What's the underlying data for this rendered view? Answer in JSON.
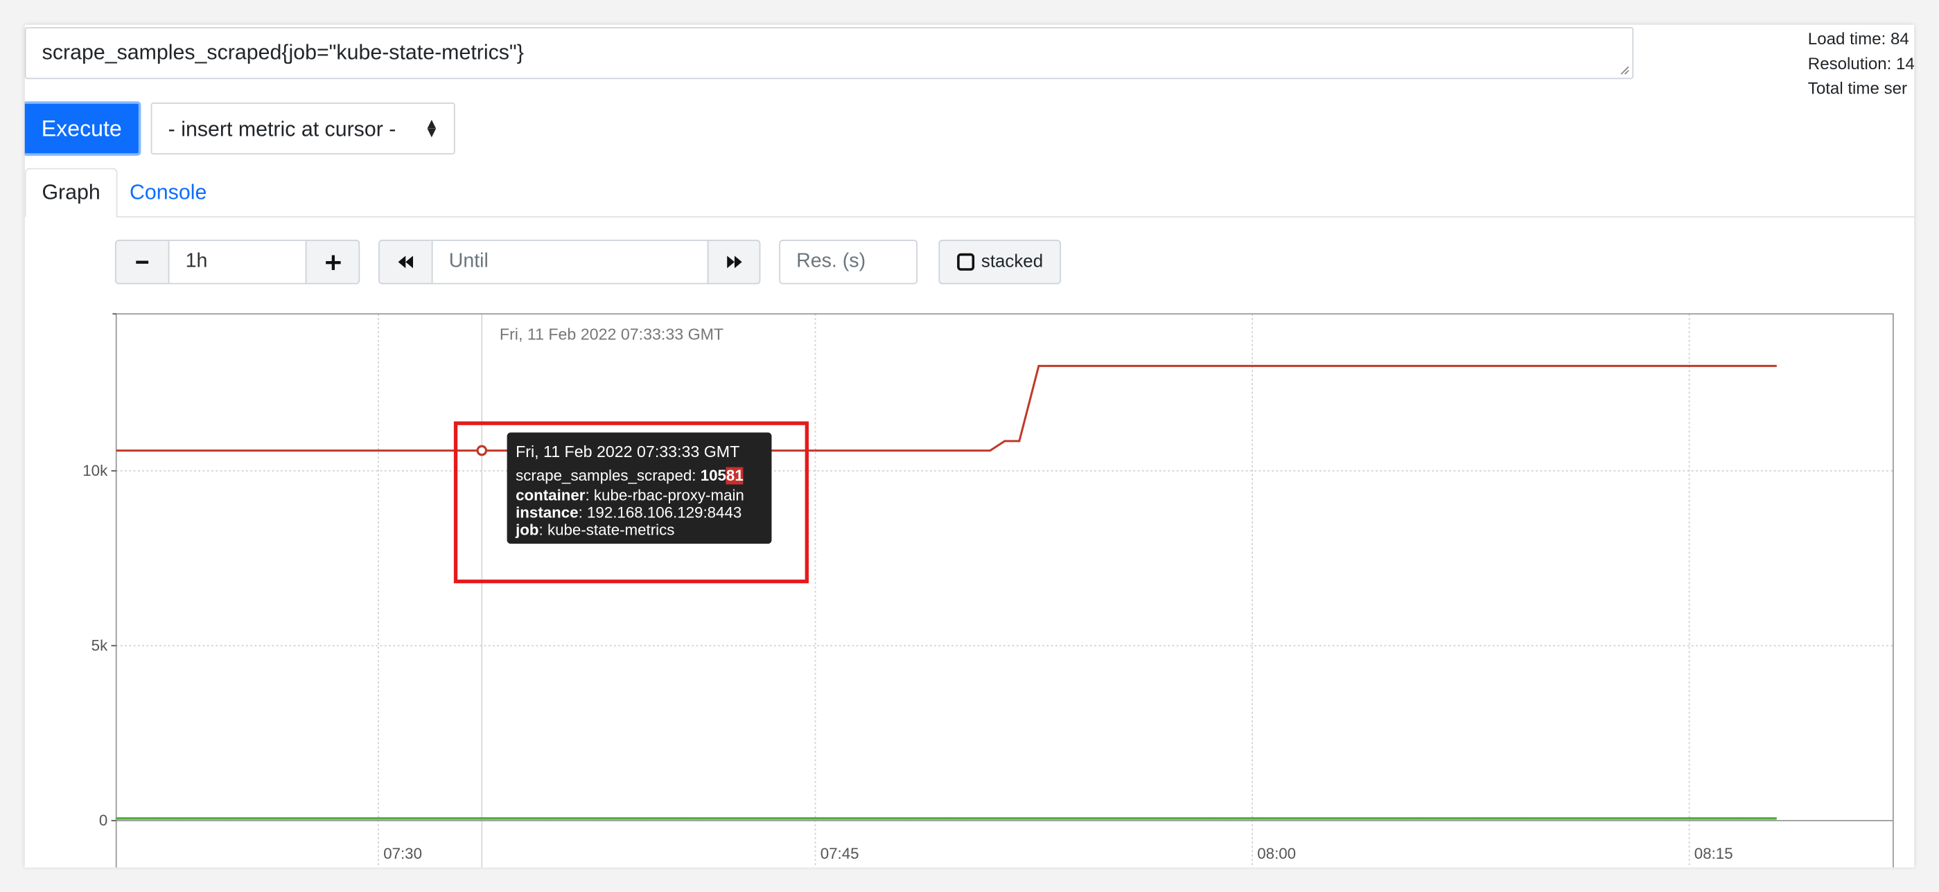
{
  "query": {
    "expression": "scrape_samples_scraped{job=\"kube-state-metrics\"}"
  },
  "stats": {
    "load_time": "Load time: 84",
    "resolution": "Resolution: 14",
    "total_time_series": "Total time ser"
  },
  "toolbar": {
    "execute_label": "Execute",
    "metric_select_value": "- insert metric at cursor -"
  },
  "tabs": [
    {
      "label": "Graph",
      "active": true
    },
    {
      "label": "Console",
      "active": false
    }
  ],
  "controls": {
    "range_value": "1h",
    "end_placeholder": "Until",
    "resolution_placeholder": "Res. (s)",
    "stacked_label": "stacked",
    "stacked_checked": false
  },
  "icons": {
    "minus": "minus-icon",
    "plus": "plus-icon",
    "back": "backward-icon",
    "forward": "forward-icon",
    "resize": "resize-grip-icon"
  },
  "hover": {
    "time_label": "Fri, 11 Feb 2022 07:33:33 GMT",
    "tooltip": {
      "title": "Fri, 11 Feb 2022 07:33:33 GMT",
      "metric_name": "scrape_samples_scraped",
      "value_prefix": "105",
      "value_suffix": "81",
      "labels": [
        {
          "key": "container",
          "value": "kube-rbac-proxy-main"
        },
        {
          "key": "instance",
          "value": "192.168.106.129:8443"
        },
        {
          "key": "job",
          "value": "kube-state-metrics"
        }
      ]
    }
  },
  "colors": {
    "accent": "#0d6efd",
    "series_red": "#c0392b",
    "series_green": "#52b13b",
    "highlight": "#e31b1b"
  },
  "chart_data": {
    "type": "line",
    "x_ticks": [
      "07:30",
      "07:45",
      "08:00",
      "08:15"
    ],
    "y_ticks": [
      "0",
      "5k",
      "10k"
    ],
    "grid": true,
    "series": [
      {
        "color": "#c0392b",
        "points": [
          [
            "07:21",
            10581
          ],
          [
            "07:33:33",
            10581
          ],
          [
            "07:51",
            10581
          ],
          [
            "07:51:30",
            10850
          ],
          [
            "07:52",
            10850
          ],
          [
            "07:52:40",
            13000
          ],
          [
            "08:18",
            13000
          ]
        ]
      },
      {
        "color": "#52b13b",
        "points": [
          [
            "07:21",
            60
          ],
          [
            "08:18",
            60
          ]
        ]
      }
    ]
  }
}
